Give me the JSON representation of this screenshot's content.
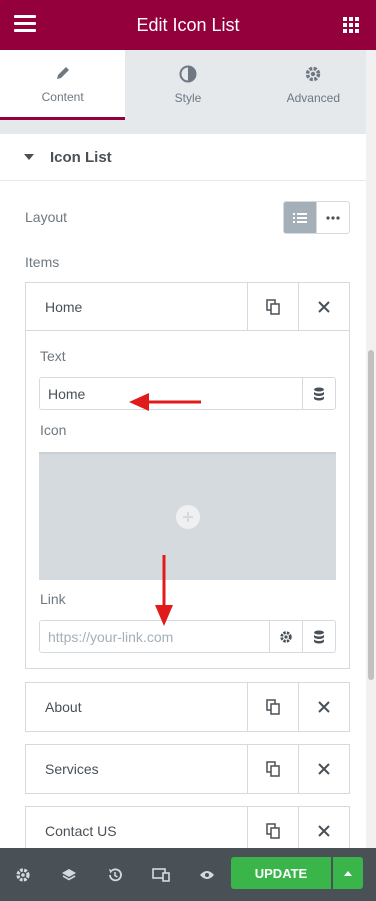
{
  "header": {
    "title": "Edit Icon List",
    "menu_icon": "hamburger-icon",
    "apps_icon": "grid-icon"
  },
  "tabs": [
    {
      "label": "Content",
      "icon": "pencil-icon",
      "active": true
    },
    {
      "label": "Style",
      "icon": "half-circle-icon",
      "active": false
    },
    {
      "label": "Advanced",
      "icon": "gear-icon",
      "active": false
    }
  ],
  "section": {
    "title": "Icon List"
  },
  "controls": {
    "layout_label": "Layout",
    "items_label": "Items"
  },
  "items": [
    {
      "label": "Home",
      "expanded": true,
      "fields": {
        "text_label": "Text",
        "text_value": "Home",
        "icon_label": "Icon",
        "link_label": "Link",
        "link_placeholder": "https://your-link.com"
      }
    },
    {
      "label": "About",
      "expanded": false
    },
    {
      "label": "Services",
      "expanded": false
    },
    {
      "label": "Contact US",
      "expanded": false
    }
  ],
  "footer": {
    "update_label": "UPDATE",
    "icons": [
      "settings-icon",
      "layers-icon",
      "history-icon",
      "responsive-icon",
      "preview-icon"
    ]
  },
  "colors": {
    "brand": "#93003c",
    "update": "#39b54a",
    "footer": "#495157",
    "annotation": "#e01b1b"
  }
}
